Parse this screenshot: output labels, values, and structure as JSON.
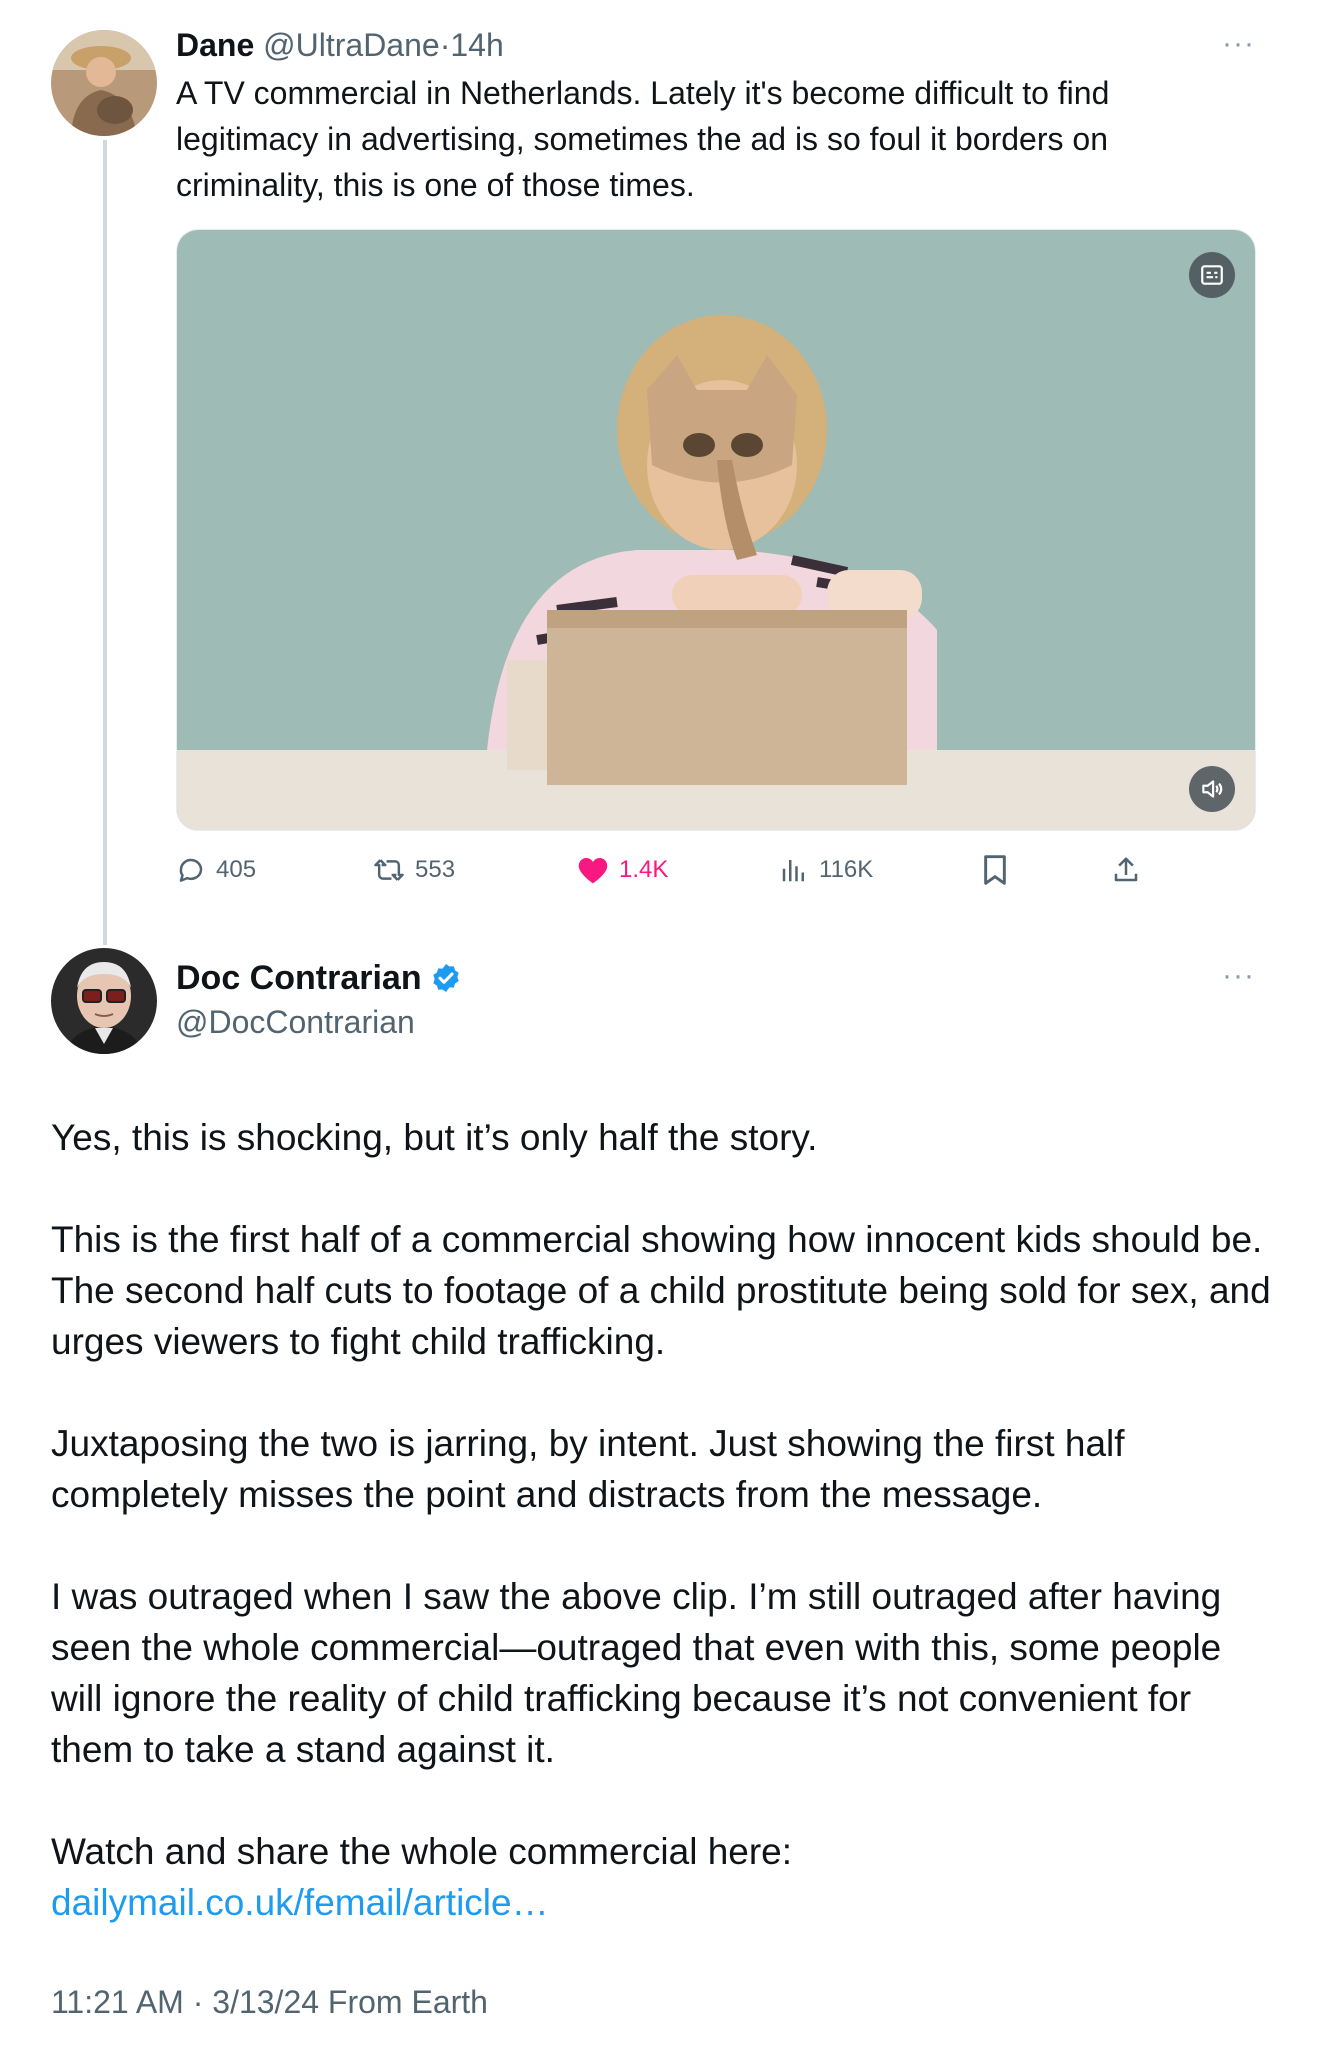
{
  "thread": {
    "parent": {
      "name": "Dane",
      "handle": "@UltraDane",
      "separator": "·",
      "time": "14h",
      "text": "A TV commercial in Netherlands. Lately it's become difficult to find legitimacy in advertising, sometimes the ad is so foul it borders on criminality, this is one of those times.",
      "more_icon": "more-dots-icon",
      "media": {
        "type": "video",
        "captions_icon": "captions-icon",
        "volume_icon": "volume-icon"
      },
      "metrics": {
        "replies": "405",
        "reposts": "553",
        "likes": "1.4K",
        "views": "116K"
      },
      "liked": true,
      "like_color": "#f91880"
    },
    "main": {
      "name": "Doc Contrarian",
      "verified": true,
      "verified_color": "#1d9bf0",
      "handle": "@DocContrarian",
      "more_icon": "more-dots-icon",
      "paragraphs": [
        "Yes, this is shocking, but it’s only half the story.",
        "This is the first half of a commercial showing how innocent kids should be. The second half cuts to footage of a child prostitute being sold for sex, and urges viewers to fight child trafficking.",
        "Juxtaposing the two is jarring, by intent. Just showing the first half completely misses the point and distracts from the message.",
        "I was outraged when I saw the above clip. I’m still outraged after having seen the whole commercial—outraged that even with this, some people will ignore the reality of child trafficking because it’s not convenient for them to take a stand against it."
      ],
      "last_paragraph_prefix": "Watch and share the whole commercial here: ",
      "link_text": "dailymail.co.uk/femail/article…",
      "timestamp": "11:21 AM · 3/13/24 From Earth"
    }
  },
  "colors": {
    "text": "#0f1419",
    "muted": "#536471",
    "link": "#1d9bf0",
    "thread_line": "#cfd9de"
  }
}
